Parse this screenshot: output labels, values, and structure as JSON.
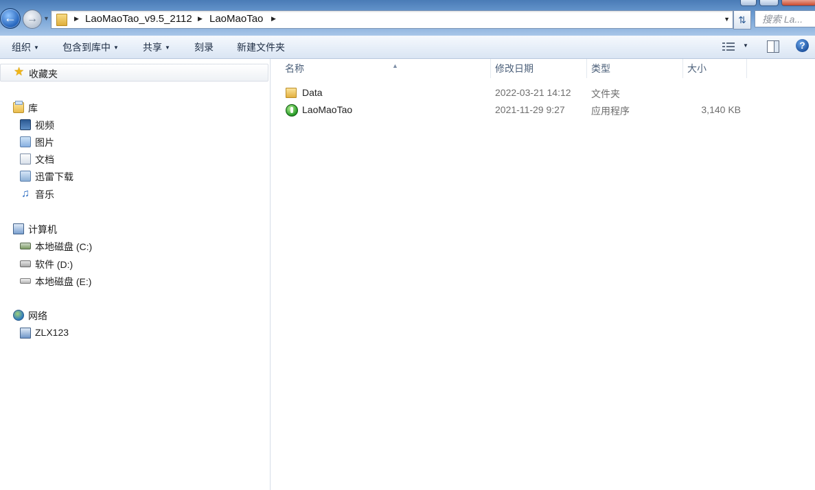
{
  "address_bar": {
    "breadcrumbs": [
      "LaoMaoTao_v9.5_2112",
      "LaoMaoTao"
    ],
    "search_placeholder": "搜索 La..."
  },
  "toolbar": {
    "organize": "组织",
    "include_in_library": "包含到库中",
    "share": "共享",
    "burn": "刻录",
    "new_folder": "新建文件夹"
  },
  "nav": {
    "favorites": "收藏夹",
    "libraries": {
      "label": "库",
      "items": [
        "视频",
        "图片",
        "文档",
        "迅雷下载",
        "音乐"
      ]
    },
    "computer": {
      "label": "计算机",
      "items": [
        "本地磁盘 (C:)",
        "软件 (D:)",
        "本地磁盘 (E:)"
      ]
    },
    "network": {
      "label": "网络",
      "items": [
        "ZLX123"
      ]
    }
  },
  "columns": {
    "name": "名称",
    "modified": "修改日期",
    "type": "类型",
    "size": "大小"
  },
  "files": [
    {
      "name": "Data",
      "modified": "2022-03-21 14:12",
      "type": "文件夹",
      "size": "",
      "icon": "folder-icon"
    },
    {
      "name": "LaoMaoTao",
      "modified": "2021-11-29 9:27",
      "type": "应用程序",
      "size": "3,140 KB",
      "icon": "app-icon"
    }
  ],
  "colors": {
    "titlebar_top": "#4a7bb6",
    "toolbar_bg": "#e6eef8",
    "column_header_text": "#4c607a",
    "meta_text": "#6d6d6d"
  }
}
